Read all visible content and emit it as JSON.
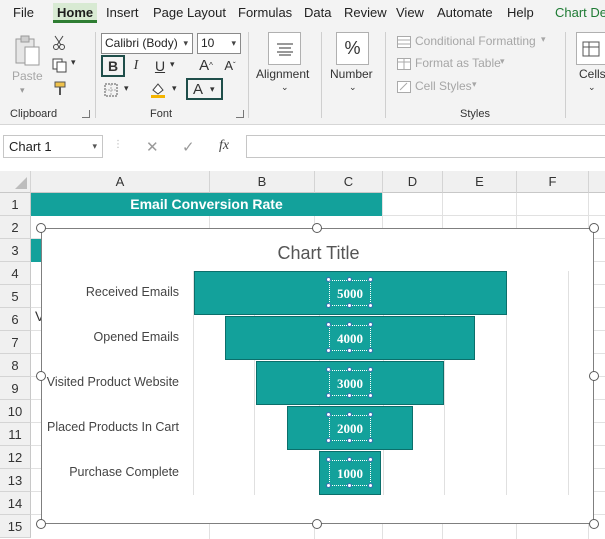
{
  "menu": {
    "items": [
      "File",
      "Home",
      "Insert",
      "Page Layout",
      "Formulas",
      "Data",
      "Review",
      "View",
      "Automate",
      "Help",
      "Chart De"
    ],
    "active": "Home"
  },
  "ribbon": {
    "clipboard": {
      "paste": "Paste",
      "label": "Clipboard"
    },
    "font": {
      "name": "Calibri (Body)",
      "size": "10",
      "bold": "B",
      "italic": "I",
      "underline": "U",
      "grow": "A",
      "shrink": "A",
      "font_color": "A",
      "label": "Font"
    },
    "alignment": {
      "label": "Alignment"
    },
    "number": {
      "label": "Number",
      "symbol": "%"
    },
    "styles": {
      "conditional": "Conditional Formatting",
      "table": "Format as Table",
      "cell_styles": "Cell Styles",
      "label": "Styles"
    },
    "cells": {
      "label": "Cells"
    }
  },
  "formula_bar": {
    "name_box": "Chart 1",
    "fx": "fx",
    "value": ""
  },
  "sheet": {
    "columns": [
      "A",
      "B",
      "C",
      "D",
      "E",
      "F"
    ],
    "rows": [
      "1",
      "2",
      "3",
      "4",
      "5",
      "6",
      "7",
      "8",
      "9",
      "10",
      "11",
      "12",
      "13",
      "14",
      "15"
    ],
    "title_cell": "Email Conversion Rate",
    "a6_peek": "V"
  },
  "chart_data": {
    "type": "bar",
    "subtype": "funnel",
    "title": "Chart Title",
    "categories": [
      "Received Emails",
      "Opened Emails",
      "Visited Product Website",
      "Placed Products In Cart",
      "Purchase Complete"
    ],
    "values": [
      5000,
      4000,
      3000,
      2000,
      1000
    ],
    "value_labels": [
      "5000",
      "4000",
      "3000",
      "2000",
      "1000"
    ],
    "xlim": [
      0,
      5000
    ],
    "grid": true,
    "bar_color": "#13a19b"
  },
  "colors": {
    "accent": "#13a19b",
    "home_tab": "#d8ead3"
  }
}
